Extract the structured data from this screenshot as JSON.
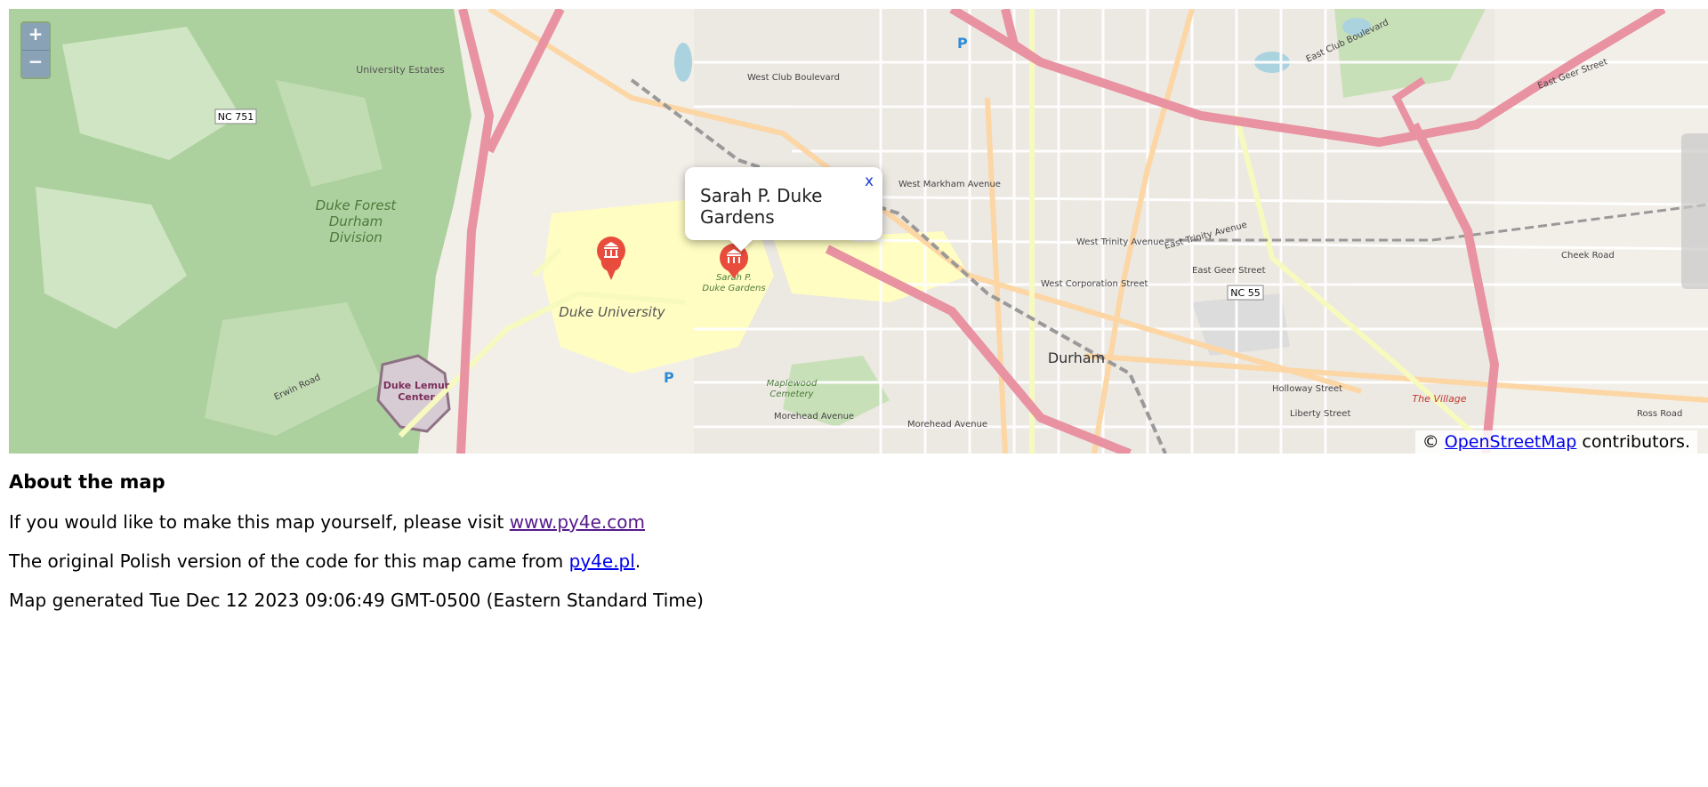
{
  "map": {
    "zoom_in": "+",
    "zoom_out": "−",
    "attribution_prefix": "©",
    "attribution_link": "OpenStreetMap",
    "attribution_suffix": "contributors.",
    "popup_text": "Sarah P. Duke Gardens",
    "popup_close": "x",
    "labels": {
      "duke_university": "Duke University",
      "durham": "Durham",
      "duke_forest": "Duke Forest",
      "durham_forest": "Durham",
      "division": "Division",
      "lemur_1": "Duke Lemur",
      "lemur_2": "Center",
      "maplewood": "Maplewood",
      "cemetery": "Cemetery",
      "university_estates": "University Estates",
      "nc751": "NC 751",
      "nc55": "NC 55",
      "the_village": "The Village",
      "west_club": "West Club Boulevard",
      "west_markham": "West Markham Avenue",
      "west_trinity": "West Trinity Avenue",
      "east_trinity": "East Trinity Avenue",
      "east_geer": "East Geer Street",
      "holloway": "Holloway Street",
      "liberty": "Liberty Street",
      "morehead": "Morehead Avenue",
      "morehead2": "Morehead Avenue",
      "cheek": "Cheek Road",
      "ross": "Ross Road",
      "duke_gardens_1": "Sarah P.",
      "duke_gardens_2": "Duke Gardens",
      "erwin": "Erwin Road",
      "west_corporation": "West Corporation Street",
      "east_club": "East Club Boulevard",
      "east_geer_upper": "East Geer Street"
    },
    "colors": {
      "water": "#aad3df",
      "forest": "#add19e",
      "motorway": "#e892a2",
      "trunk": "#f9b29c",
      "primary": "#fcd6a4",
      "campus": "#fffdc2",
      "marker": "#e74c3c"
    }
  },
  "about": {
    "heading": "About the map",
    "line1_prefix": "If you would like to make this map yourself, please visit",
    "line1_link": "www.py4e.com",
    "line2_prefix": "The original Polish version of the code for this map came from",
    "line2_link": "py4e.pl",
    "line2_suffix": ".",
    "line3": "Map generated Tue Dec 12 2023 09:06:49 GMT-0500 (Eastern Standard Time)"
  }
}
